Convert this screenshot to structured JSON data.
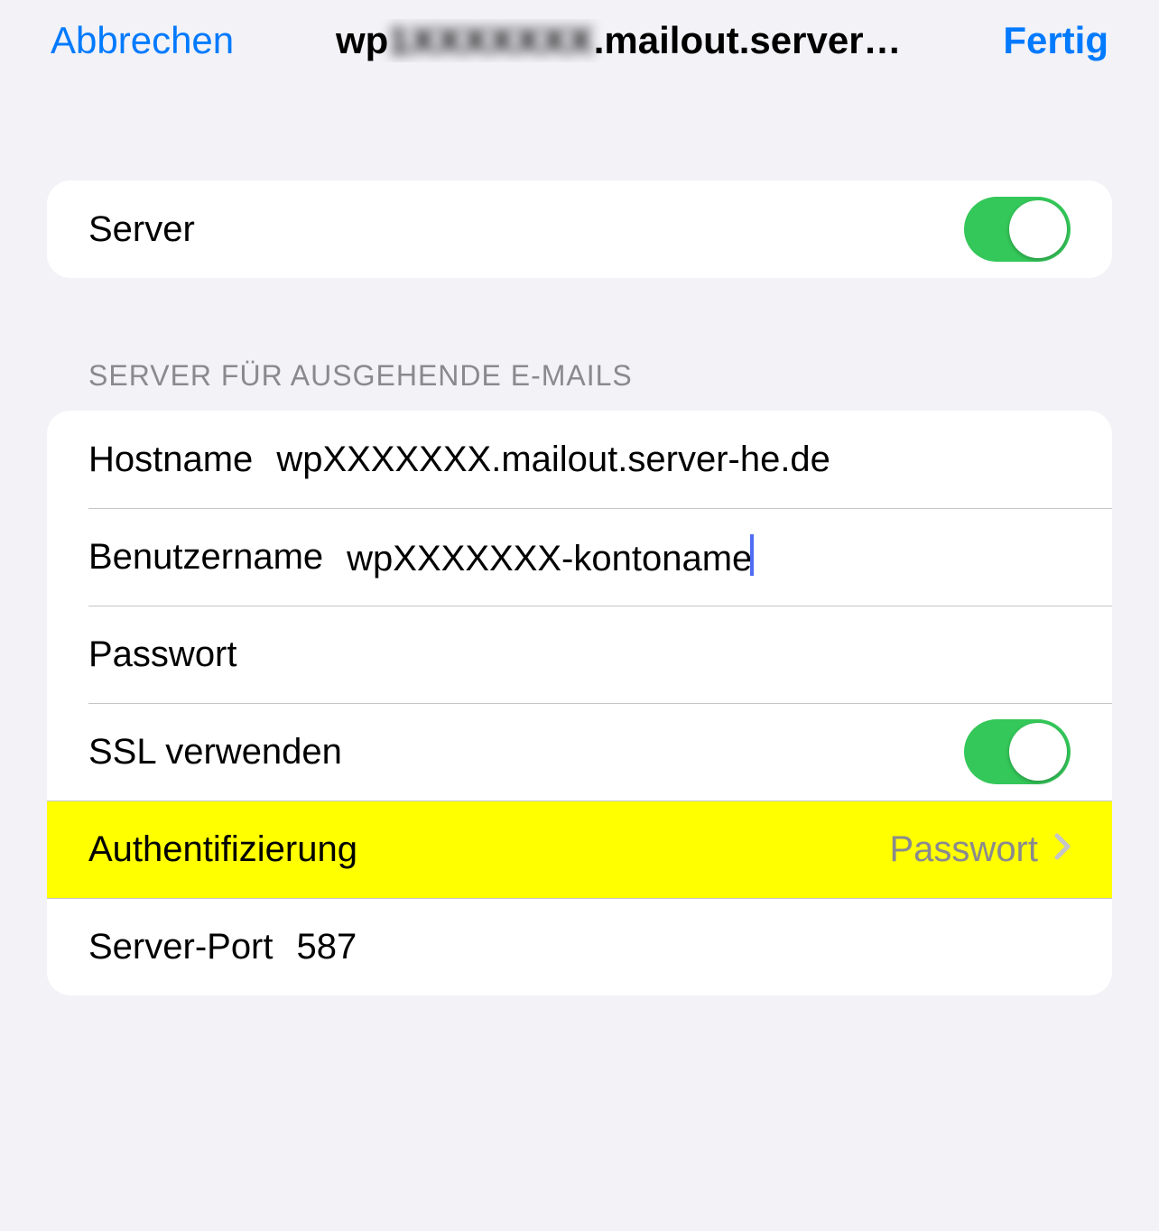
{
  "nav": {
    "cancel_label": "Abbrechen",
    "done_label": "Fertig",
    "title_prefix": "wp",
    "title_blurred": "1XXXXXXX",
    "title_suffix": ".mailout.server…"
  },
  "server_toggle": {
    "label": "Server",
    "on": true
  },
  "outgoing_header": "SERVER FÜR AUSGEHENDE E-MAILS",
  "outgoing": {
    "hostname_label": "Hostname",
    "hostname_value": "wpXXXXXXX.mailout.server-he.de",
    "username_label": "Benutzername",
    "username_value": "wpXXXXXXX-kontoname",
    "password_label": "Passwort",
    "password_value": "",
    "ssl_label": "SSL verwenden",
    "ssl_on": true,
    "auth_label": "Authentifizierung",
    "auth_value": "Passwort",
    "port_label": "Server-Port",
    "port_value": "587"
  }
}
